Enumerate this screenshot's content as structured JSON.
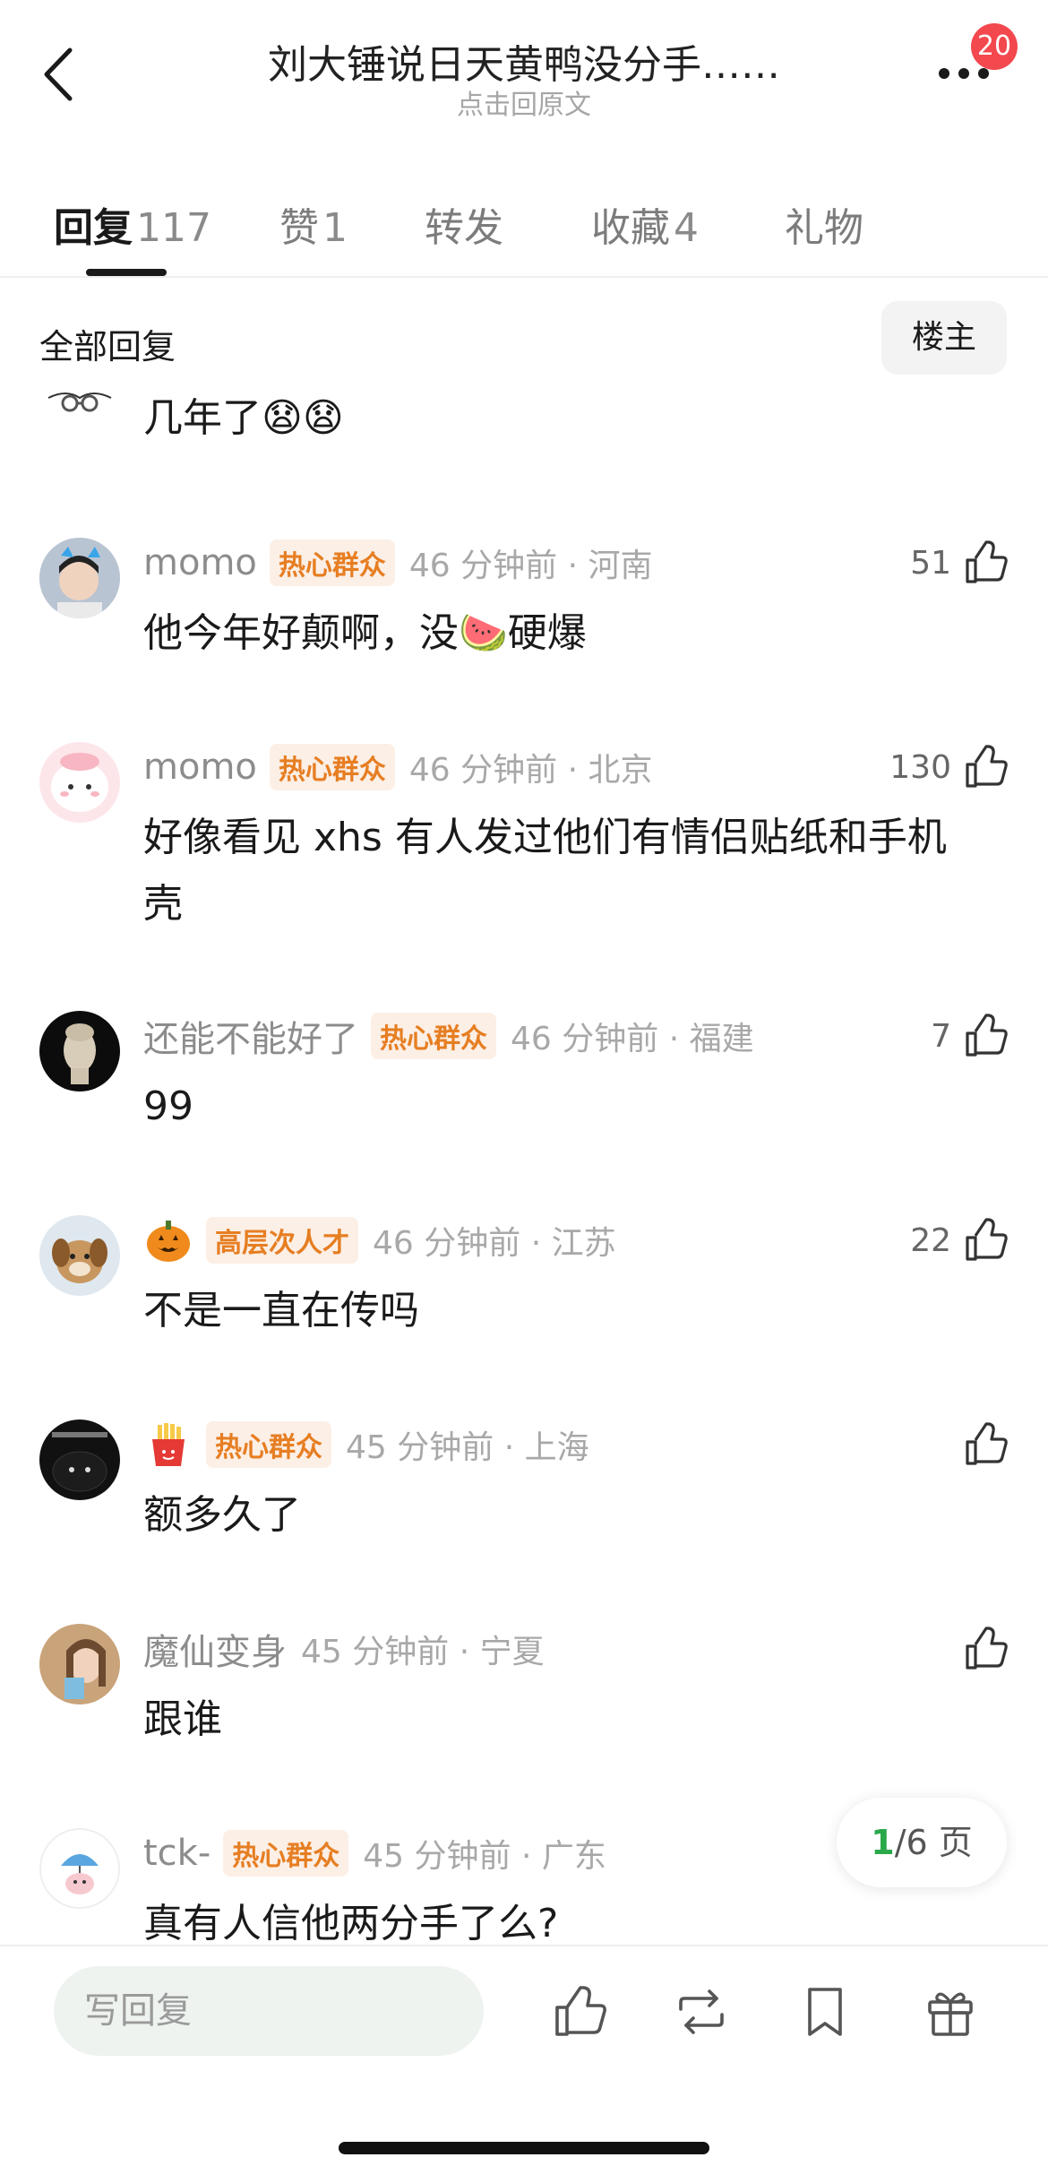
{
  "header": {
    "title": "刘大锤说日天黄鸭没分手……",
    "subtitle": "点击回原文",
    "badge_count": "20"
  },
  "tabs": [
    {
      "name": "回复",
      "count": "117",
      "active": true
    },
    {
      "name": "赞",
      "count": "1",
      "active": false
    },
    {
      "name": "转发",
      "count": "",
      "active": false
    },
    {
      "name": "收藏",
      "count": "4",
      "active": false
    },
    {
      "name": "礼物",
      "count": "",
      "active": false
    }
  ],
  "section": {
    "title": "全部回复",
    "owner_filter": "楼主"
  },
  "comments": [
    {
      "partial": true,
      "content": "几年了😧😧"
    },
    {
      "username": "momo",
      "tag": "热心群众",
      "time": "46 分钟前 · 河南",
      "likes": "51",
      "content": "他今年好颠啊，没🍉硬爆"
    },
    {
      "username": "momo",
      "tag": "热心群众",
      "time": "46 分钟前 · 北京",
      "likes": "130",
      "content": "好像看见 xhs 有人发过他们有情侣贴纸和手机壳"
    },
    {
      "username": "还能不能好了",
      "tag": "热心群众",
      "time": "46 分钟前 · 福建",
      "likes": "7",
      "content": "99"
    },
    {
      "username": "",
      "name_icon": "pumpkin-icon",
      "tag": "高层次人才",
      "time": "46 分钟前 · 江苏",
      "likes": "22",
      "content": "不是一直在传吗"
    },
    {
      "username": "",
      "name_icon": "fries-icon",
      "tag": "热心群众",
      "time": "45 分钟前 · 上海",
      "likes": "",
      "content": "额多久了"
    },
    {
      "username": "魔仙变身",
      "tag": "",
      "time": "45 分钟前 · 宁夏",
      "likes": "",
      "content": "跟谁"
    },
    {
      "username": "tck-",
      "tag": "热心群众",
      "time": "45 分钟前 · 广东",
      "likes": "",
      "content": "真有人信他两分手了么?"
    }
  ],
  "pagination": {
    "current": "1",
    "total_text": "/6 页"
  },
  "bottom_bar": {
    "reply_placeholder": "写回复",
    "icons": [
      "like-icon",
      "repost-icon",
      "bookmark-icon",
      "gift-icon"
    ]
  },
  "colors": {
    "tag_bg": "#fcefe6",
    "tag_text": "#e67e22",
    "badge": "#f2484e",
    "page_current": "#2aa84a",
    "reply_bg": "#eef3ef"
  }
}
